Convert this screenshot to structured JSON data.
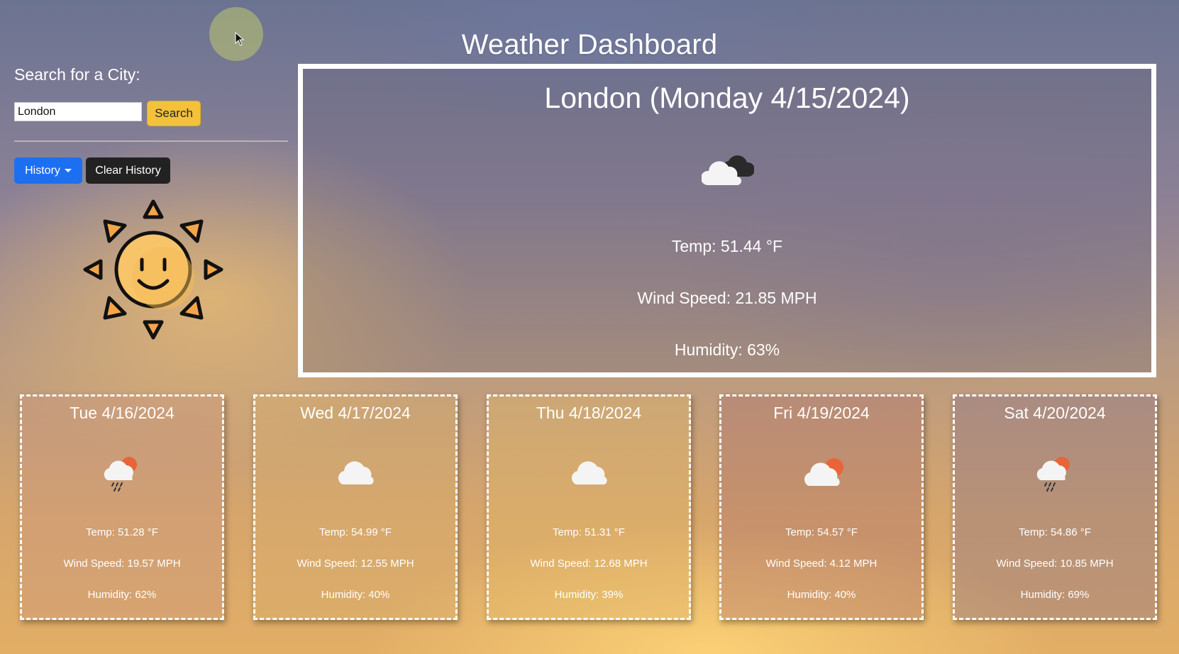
{
  "header": {
    "title": "Weather Dashboard"
  },
  "sidebar": {
    "search_label": "Search for a City:",
    "city_input_value": "London",
    "search_button": "Search",
    "history_button": "History",
    "clear_history_button": "Clear History",
    "logo_icon": "smiling-sun-icon"
  },
  "current": {
    "heading": "London (Monday 4/15/2024)",
    "icon": "broken-clouds-icon",
    "temp": "Temp: 51.44 °F",
    "wind": "Wind Speed: 21.85 MPH",
    "humidity": "Humidity: 63%"
  },
  "forecast": [
    {
      "date": "Tue 4/16/2024",
      "icon": "light-rain-sun-icon",
      "temp": "Temp: 51.28 °F",
      "wind": "Wind Speed: 19.57 MPH",
      "humidity": "Humidity: 62%"
    },
    {
      "date": "Wed 4/17/2024",
      "icon": "cloud-icon",
      "temp": "Temp: 54.99 °F",
      "wind": "Wind Speed: 12.55 MPH",
      "humidity": "Humidity: 40%"
    },
    {
      "date": "Thu 4/18/2024",
      "icon": "cloud-icon",
      "temp": "Temp: 51.31 °F",
      "wind": "Wind Speed: 12.68 MPH",
      "humidity": "Humidity: 39%"
    },
    {
      "date": "Fri 4/19/2024",
      "icon": "cloud-sun-icon",
      "temp": "Temp: 54.57 °F",
      "wind": "Wind Speed: 4.12 MPH",
      "humidity": "Humidity: 40%"
    },
    {
      "date": "Sat 4/20/2024",
      "icon": "light-rain-sun-icon",
      "temp": "Temp: 54.86 °F",
      "wind": "Wind Speed: 10.85 MPH",
      "humidity": "Humidity: 69%"
    }
  ],
  "colors": {
    "search_button": "#f3c13a",
    "history_button": "#1d6ff2",
    "clear_button": "#222222"
  }
}
